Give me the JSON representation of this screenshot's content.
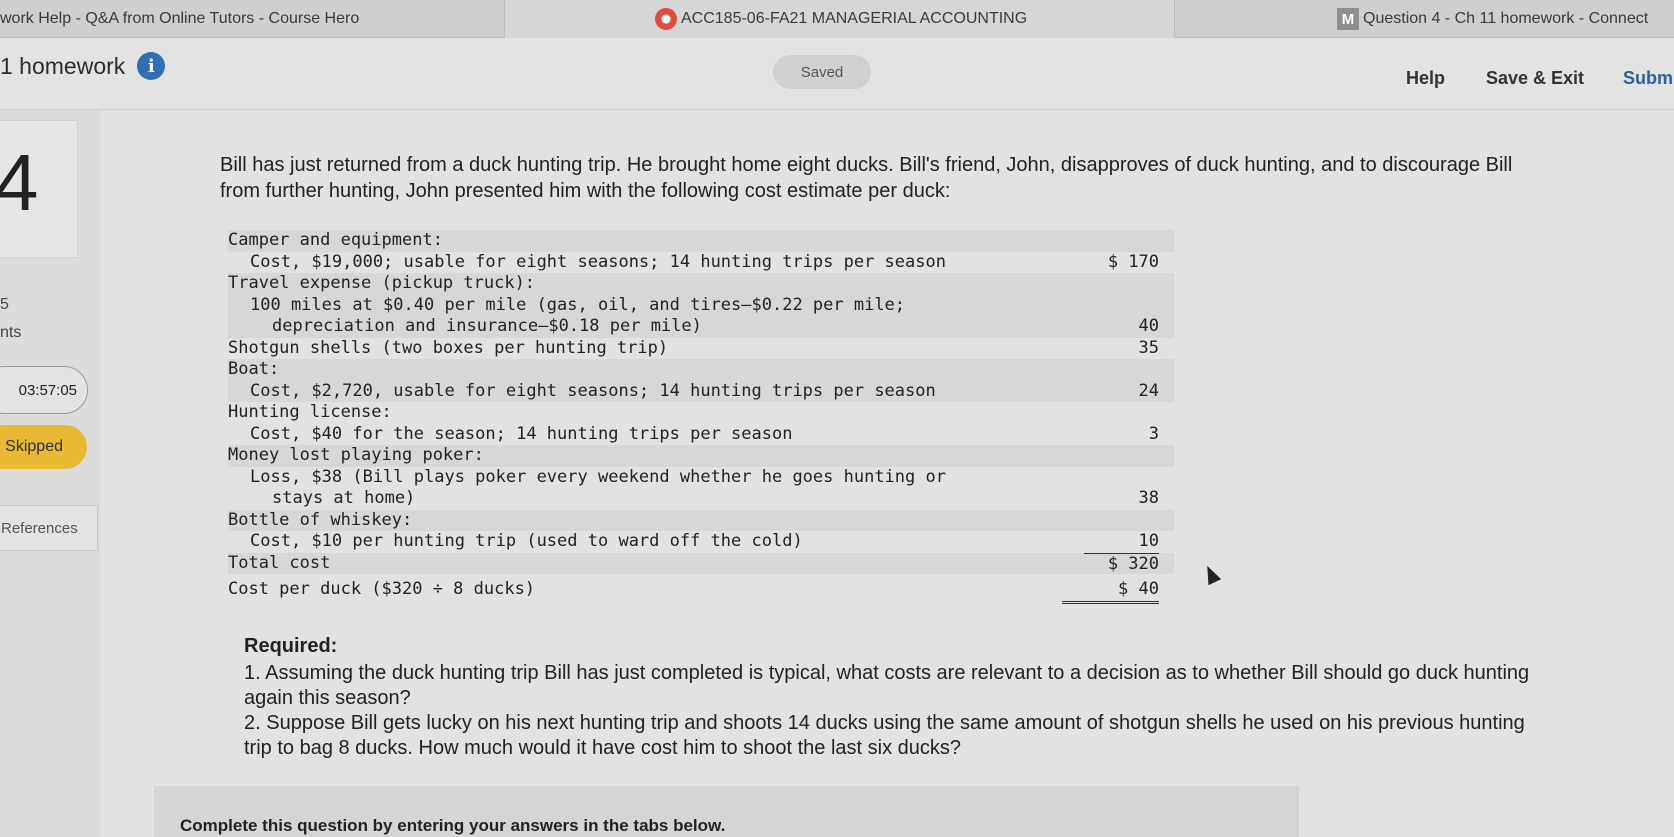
{
  "browser_tabs": [
    {
      "label": "work Help - Q&A from Online Tutors - Course Hero"
    },
    {
      "label": "ACC185-06-FA21 MANAGERIAL ACCOUNTING"
    },
    {
      "label": "Question 4 - Ch 11 homework - Connect"
    }
  ],
  "header": {
    "title": "1 homework",
    "saved": "Saved",
    "help": "Help",
    "save_exit": "Save & Exit",
    "submit": "Subm"
  },
  "sidebar": {
    "question_number": "4",
    "points_value": "5",
    "points_label": "nts",
    "timer": "03:57:05",
    "status": "Skipped",
    "references": "References"
  },
  "question": {
    "intro": "Bill has just returned from a duck hunting trip. He brought home eight ducks. Bill's friend, John, disapproves of duck hunting, and to discourage Bill from further hunting, John presented him with the following cost estimate per duck:",
    "rows": [
      {
        "label": "Camper and equipment:",
        "amount": ""
      },
      {
        "label": "  Cost, $19,000; usable for eight seasons; 14 hunting trips per season",
        "amount": "$ 170"
      },
      {
        "label": "Travel expense (pickup truck):",
        "amount": ""
      },
      {
        "label": "  100 miles at $0.40 per mile (gas, oil, and tires–$0.22 per mile;",
        "amount": ""
      },
      {
        "label": "    depreciation and insurance–$0.18 per mile)",
        "amount": "40"
      },
      {
        "label": "Shotgun shells (two boxes per hunting trip)",
        "amount": "35"
      },
      {
        "label": "Boat:",
        "amount": ""
      },
      {
        "label": "  Cost, $2,720, usable for eight seasons; 14 hunting trips per season",
        "amount": "24"
      },
      {
        "label": "Hunting license:",
        "amount": ""
      },
      {
        "label": "  Cost, $40 for the season; 14 hunting trips per season",
        "amount": "3"
      },
      {
        "label": "Money lost playing poker:",
        "amount": ""
      },
      {
        "label": "  Loss, $38 (Bill plays poker every weekend whether he goes hunting or",
        "amount": ""
      },
      {
        "label": "    stays at home)",
        "amount": "38"
      },
      {
        "label": "Bottle of whiskey:",
        "amount": ""
      },
      {
        "label": "  Cost, $10 per hunting trip (used to ward off the cold)",
        "amount": "10"
      },
      {
        "label": "Total cost",
        "amount": "$ 320"
      },
      {
        "label": "Cost per duck ($320 ÷ 8 ducks)",
        "amount": "$ 40"
      }
    ],
    "required_heading": "Required:",
    "required_1": "1. Assuming the duck hunting trip Bill has just completed is typical, what costs are relevant to a decision as to whether Bill should go duck hunting again this season?",
    "required_2": "2. Suppose Bill gets lucky on his next hunting trip and shoots 14 ducks using the same amount of shotgun shells he used on his previous hunting trip to bag 8 ducks. How much would it have cost him to shoot the last six ducks?",
    "instruction": "Complete this question by entering your answers in the tabs below."
  }
}
